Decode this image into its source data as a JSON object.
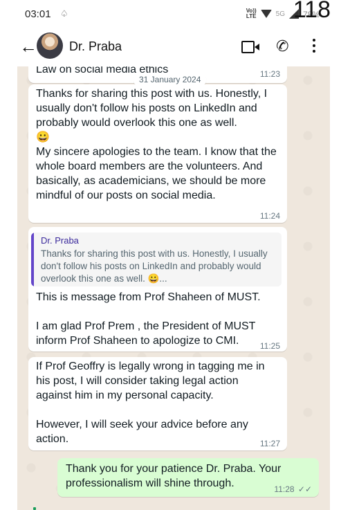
{
  "statusbar": {
    "time": "03:01",
    "small_icon": "notification-icon",
    "volte": "Vo)) LTE",
    "network": "5G",
    "battery": "78%",
    "overlay_number": "118"
  },
  "header": {
    "contact_name": "Dr. Praba",
    "icons": [
      "back-arrow-icon",
      "avatar",
      "video-call-icon",
      "voice-call-icon",
      "more-options-icon"
    ]
  },
  "chat": {
    "partial_top_text": "Law on social media ethics",
    "date_chip": "31 January 2024",
    "messages": [
      {
        "direction": "in",
        "time": "11:23",
        "text": ""
      },
      {
        "direction": "in",
        "time": "11:24",
        "text": "Thanks for sharing this post with us. Honestly, I usually don't follow his posts on LinkedIn and probably would overlook this one as well.\n😀\nMy sincere apologies to the team. I know that the whole board members are the volunteers. And basically, as academicians, we should be more mindful of our posts on social media."
      },
      {
        "direction": "in",
        "time": "11:25",
        "quote_author": "Dr. Praba",
        "quote_text": "Thanks for sharing this post with us. Honestly, I usually don't follow his posts on LinkedIn and probably would overlook this one as well. 😀...",
        "text": "This is message from Prof Shaheen of MUST.\n\nI am glad Prof Prem , the President of MUST inform Prof Shaheen to apologize to CMI."
      },
      {
        "direction": "in",
        "time": "11:27",
        "text": "If Prof Geoffry is legally wrong in tagging me in his post, I will consider taking legal action against him in my personal capacity.\n\nHowever, I will seek your advice before any action."
      },
      {
        "direction": "out",
        "time": "11:28",
        "ticks": "✓✓",
        "text": "Thank you for your patience Dr. Praba. Your professionalism will shine through."
      }
    ]
  },
  "colors": {
    "chat_background": "#efe7dd",
    "incoming_bubble": "#ffffff",
    "outgoing_bubble": "#d9fdd3",
    "quote_bar": "#6345c9"
  }
}
